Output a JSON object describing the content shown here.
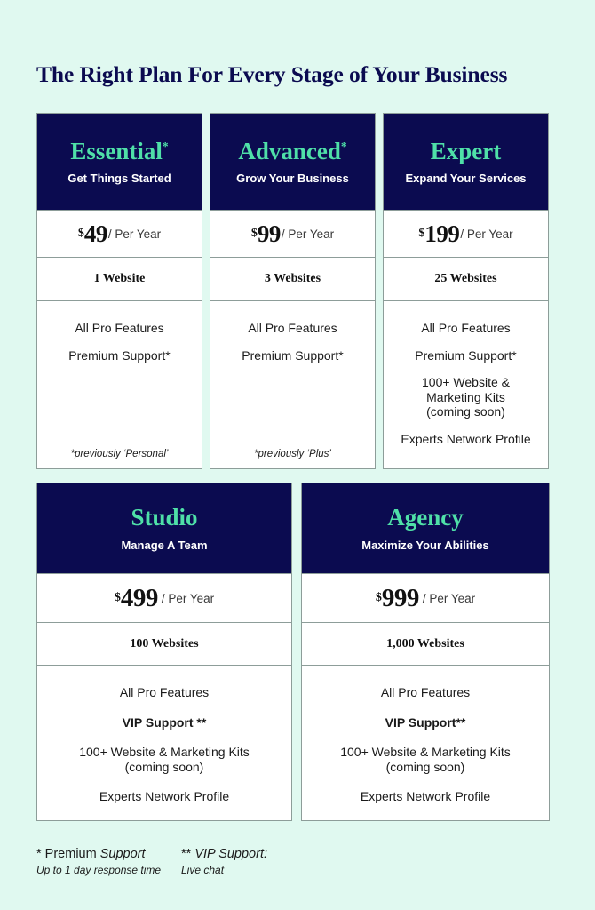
{
  "theme": {
    "page_background": "#e0f9f0",
    "navy": "#0b0b50",
    "mint": "#4fe0a8",
    "card_background": "#ffffff",
    "border": "#8d9d99"
  },
  "header": {
    "title": "The Right Plan For Every Stage of Your Business"
  },
  "plans": {
    "essential": {
      "name": "Essential",
      "name_marker": "*",
      "tagline": "Get Things Started",
      "currency": "$",
      "price": "49",
      "period": "/ Per Year",
      "websites": "1 Website",
      "features": [
        "All Pro Features",
        "Premium Support*"
      ],
      "footnote": "*previously ‘Personal’"
    },
    "advanced": {
      "name": "Advanced",
      "name_marker": "*",
      "tagline": "Grow Your Business",
      "currency": "$",
      "price": "99",
      "period": "/ Per Year",
      "websites": "3 Websites",
      "features": [
        "All Pro Features",
        "Premium Support*"
      ],
      "footnote": "*previously ‘Plus’"
    },
    "expert": {
      "name": "Expert",
      "name_marker": "",
      "tagline": "Expand Your Services",
      "currency": "$",
      "price": "199",
      "period": "/ Per Year",
      "websites": "25 Websites",
      "features": [
        "All Pro Features",
        "Premium Support*",
        "100+ Website &\nMarketing Kits\n(coming soon)",
        "Experts Network Profile"
      ],
      "footnote": ""
    },
    "studio": {
      "name": "Studio",
      "name_marker": "",
      "tagline": "Manage A Team",
      "currency": "$",
      "price": "499",
      "period": "/ Per Year",
      "websites": "100 Websites",
      "features": [
        "All Pro Features",
        "VIP Support **",
        "100+ Website & Marketing Kits\n(coming soon)",
        "Experts Network Profile"
      ],
      "footnote": ""
    },
    "agency": {
      "name": "Agency",
      "name_marker": "",
      "tagline": "Maximize Your Abilities",
      "currency": "$",
      "price": "999",
      "period": "/ Per Year",
      "websites": "1,000 Websites",
      "features": [
        "All Pro Features",
        "VIP Support**",
        "100+ Website & Marketing Kits\n(coming soon)",
        "Experts Network Profile"
      ],
      "footnote": ""
    }
  },
  "legend": {
    "premium": {
      "marker": "* Premium ",
      "term": "Support",
      "description": "Up to 1 day response time"
    },
    "vip": {
      "marker": "** ",
      "term": "VIP Support:",
      "description": "Live chat"
    }
  }
}
